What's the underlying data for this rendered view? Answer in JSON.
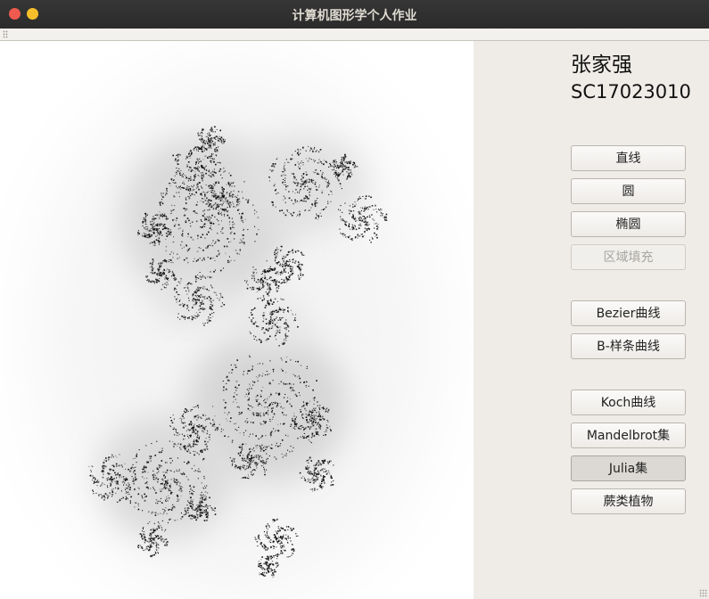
{
  "window": {
    "title": "计算机图形学个人作业"
  },
  "sidebar": {
    "name": "张家强",
    "student_id": "SC17023010",
    "buttons": [
      {
        "label": "直线",
        "state": "normal"
      },
      {
        "label": "圆",
        "state": "normal"
      },
      {
        "label": "椭圆",
        "state": "normal"
      },
      {
        "label": "区域填充",
        "state": "disabled"
      },
      {
        "label": "Bezier曲线",
        "state": "normal"
      },
      {
        "label": "B-样条曲线",
        "state": "normal"
      },
      {
        "label": "Koch曲线",
        "state": "normal"
      },
      {
        "label": "Mandelbrot集",
        "state": "normal"
      },
      {
        "label": "Julia集",
        "state": "pressed"
      },
      {
        "label": "蕨类植物",
        "state": "normal"
      }
    ]
  },
  "canvas": {
    "content": "julia-set-fractal",
    "colors": {
      "background": "#ffffff",
      "fractal": "#111111",
      "halo": "#888888"
    }
  },
  "colors": {
    "titlebar": "#2f2f2f",
    "close": "#f05a4f",
    "minimize": "#f5bf2c",
    "panel": "#efece8"
  }
}
